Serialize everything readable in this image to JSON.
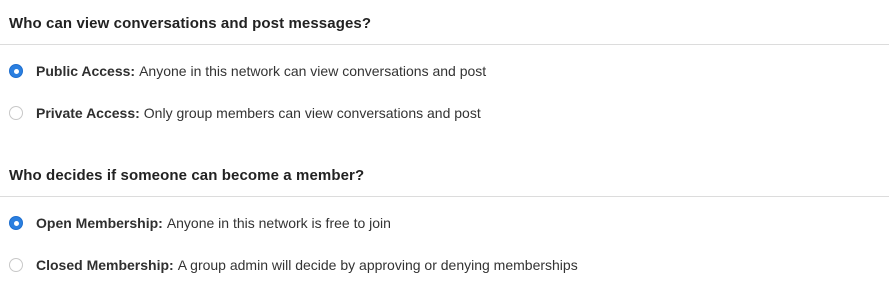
{
  "groups": [
    {
      "question": "Who can view conversations and post messages?",
      "options": [
        {
          "title": "Public Access",
          "separator": ":",
          "description": "Anyone in this network can view conversations and post",
          "selected": true
        },
        {
          "title": "Private Access",
          "separator": ":",
          "description": "Only group members can view conversations and post",
          "selected": false
        }
      ]
    },
    {
      "question": "Who decides if someone can become a member?",
      "options": [
        {
          "title": "Open Membership",
          "separator": ":",
          "description": "Anyone in this network is free to join",
          "selected": true
        },
        {
          "title": "Closed Membership",
          "separator": ":",
          "description": "A group admin will decide by approving or denying memberships",
          "selected": false
        }
      ]
    }
  ],
  "colors": {
    "radio_selected": "#2a7fe0",
    "radio_unselected_border": "#c8c8c8",
    "divider": "#dcdcdc"
  },
  "icons": {
    "selected": "radio-selected-icon",
    "unselected": "radio-unselected-icon"
  }
}
